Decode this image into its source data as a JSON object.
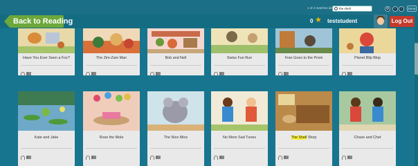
{
  "find": {
    "count_text": "1 of 4 matches",
    "query_label": "diagnostic",
    "query_value": "the shell",
    "prev_icon": "gear-icon",
    "done_label": "Done"
  },
  "header": {
    "back_label": "Back to Reading",
    "stars": "0",
    "username": "teststudent",
    "logout_label": "Log Out"
  },
  "books_row1": [
    {
      "title": "Have You Ever Seen a Fox?"
    },
    {
      "title": "The Zim-Zam Man"
    },
    {
      "title": "Bob and Nell"
    },
    {
      "title": "Swiss Fun Run"
    },
    {
      "title": "Fran Goes to the Prom"
    },
    {
      "title": "Planet Blip Blop"
    }
  ],
  "books_row2": [
    {
      "title": "Kate and Jake"
    },
    {
      "title": "Rose the Mole"
    },
    {
      "title": "The Nice Mice"
    },
    {
      "title": "No More Sad Tunes"
    },
    {
      "title_pre": "The Shell",
      "title_post": " Shop"
    },
    {
      "title": "Chase and Chet"
    }
  ],
  "colors": {
    "background": "#18758f",
    "back_button": "#6ca83b",
    "logout": "#c33a2c",
    "highlight": "#f7ee3a"
  }
}
